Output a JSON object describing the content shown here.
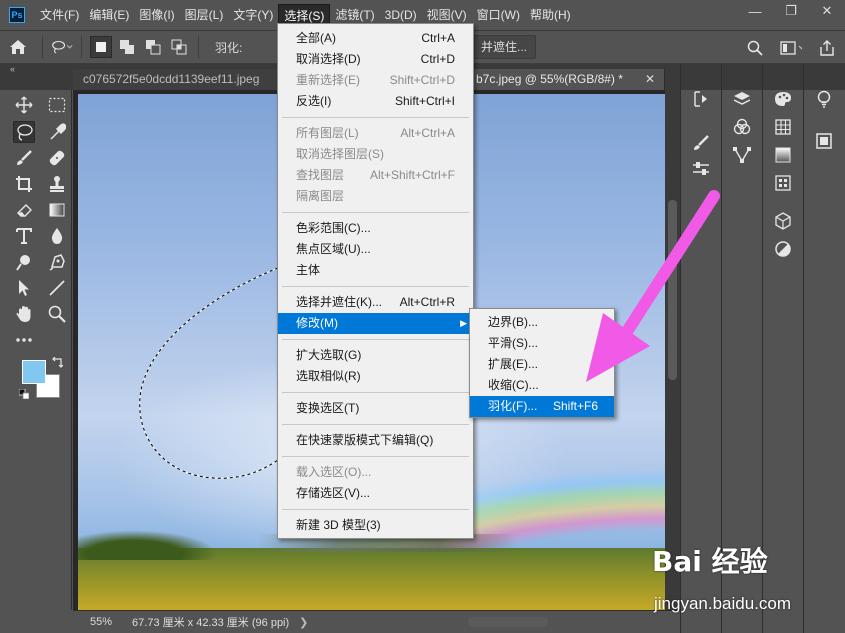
{
  "app": {
    "logo": "Ps"
  },
  "menubar": {
    "items": [
      "文件(F)",
      "编辑(E)",
      "图像(I)",
      "图层(L)",
      "文字(Y)",
      "选择(S)",
      "滤镜(T)",
      "3D(D)",
      "视图(V)",
      "窗口(W)",
      "帮助(H)"
    ],
    "active": "选择(S)"
  },
  "window_controls": {
    "minimize": "—",
    "restore": "❐",
    "close": "✕"
  },
  "optionsbar": {
    "feather_label": "羽化:",
    "select_and_mask_button": "并遮住..."
  },
  "tabs": [
    {
      "label": "c076572f5e0dcdd1139eef11.jpeg",
      "active": false
    },
    {
      "label": "b7c.jpeg @ 55%(RGB/8#) *",
      "active": true
    }
  ],
  "statusbar": {
    "zoom": "55%",
    "doc_info": "67.73 厘米 x 42.33 厘米 (96 ppi)",
    "arrow": "❯"
  },
  "select_menu": {
    "groups": [
      [
        {
          "label": "全部(A)",
          "shortcut": "Ctrl+A",
          "disabled": false
        },
        {
          "label": "取消选择(D)",
          "shortcut": "Ctrl+D",
          "disabled": false
        },
        {
          "label": "重新选择(E)",
          "shortcut": "Shift+Ctrl+D",
          "disabled": true
        },
        {
          "label": "反选(I)",
          "shortcut": "Shift+Ctrl+I",
          "disabled": false
        }
      ],
      [
        {
          "label": "所有图层(L)",
          "shortcut": "Alt+Ctrl+A",
          "disabled": true
        },
        {
          "label": "取消选择图层(S)",
          "shortcut": "",
          "disabled": true
        },
        {
          "label": "查找图层",
          "shortcut": "Alt+Shift+Ctrl+F",
          "disabled": true
        },
        {
          "label": "隔离图层",
          "shortcut": "",
          "disabled": true
        }
      ],
      [
        {
          "label": "色彩范围(C)...",
          "shortcut": "",
          "disabled": false
        },
        {
          "label": "焦点区域(U)...",
          "shortcut": "",
          "disabled": false
        },
        {
          "label": "主体",
          "shortcut": "",
          "disabled": false
        }
      ],
      [
        {
          "label": "选择并遮住(K)...",
          "shortcut": "Alt+Ctrl+R",
          "disabled": false
        },
        {
          "label": "修改(M)",
          "shortcut": "",
          "disabled": false,
          "highlighted": true,
          "submenu": true
        }
      ],
      [
        {
          "label": "扩大选取(G)",
          "shortcut": "",
          "disabled": false
        },
        {
          "label": "选取相似(R)",
          "shortcut": "",
          "disabled": false
        }
      ],
      [
        {
          "label": "变换选区(T)",
          "shortcut": "",
          "disabled": false
        }
      ],
      [
        {
          "label": "在快速蒙版模式下编辑(Q)",
          "shortcut": "",
          "disabled": false
        }
      ],
      [
        {
          "label": "载入选区(O)...",
          "shortcut": "",
          "disabled": true
        },
        {
          "label": "存储选区(V)...",
          "shortcut": "",
          "disabled": false
        }
      ],
      [
        {
          "label": "新建 3D 模型(3)",
          "shortcut": "",
          "disabled": false
        }
      ]
    ]
  },
  "modify_submenu": {
    "items": [
      {
        "label": "边界(B)...",
        "shortcut": "",
        "highlighted": false
      },
      {
        "label": "平滑(S)...",
        "shortcut": "",
        "highlighted": false
      },
      {
        "label": "扩展(E)...",
        "shortcut": "",
        "highlighted": false
      },
      {
        "label": "收缩(C)...",
        "shortcut": "",
        "highlighted": false
      },
      {
        "label": "羽化(F)...",
        "shortcut": "Shift+F6",
        "highlighted": true
      }
    ]
  },
  "colors": {
    "foreground": "#80c8f0",
    "background": "#ffffff",
    "highlight": "#0078d7",
    "annotation_arrow": "#f05ae6"
  },
  "watermark": {
    "logo": "Bai 经验",
    "site": "jingyan.baidu.com"
  }
}
